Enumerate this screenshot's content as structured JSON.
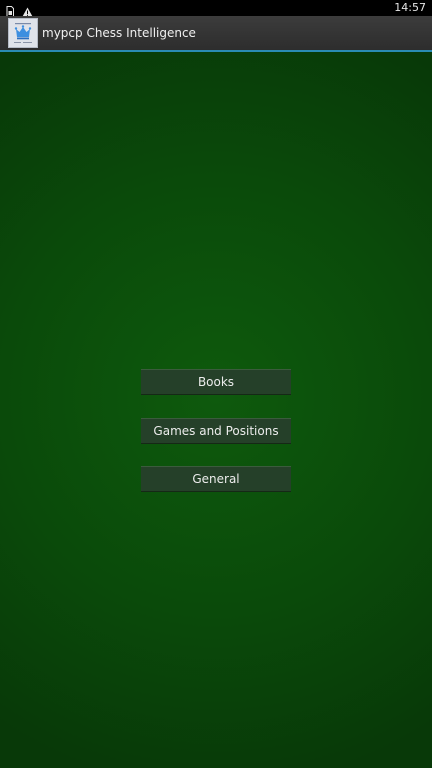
{
  "status_bar": {
    "time": "14:57",
    "icons": [
      "sim-card-icon",
      "warning-icon"
    ]
  },
  "action_bar": {
    "app_icon": "chess-app-icon",
    "title": "mypcp Chess Intelligence"
  },
  "menu": {
    "books_label": "Books",
    "games_positions_label": "Games and Positions",
    "general_label": "General"
  },
  "colors": {
    "background": "#0a4a0a",
    "action_bar_underline": "#2a8cb4",
    "button_bg": "#254029"
  }
}
